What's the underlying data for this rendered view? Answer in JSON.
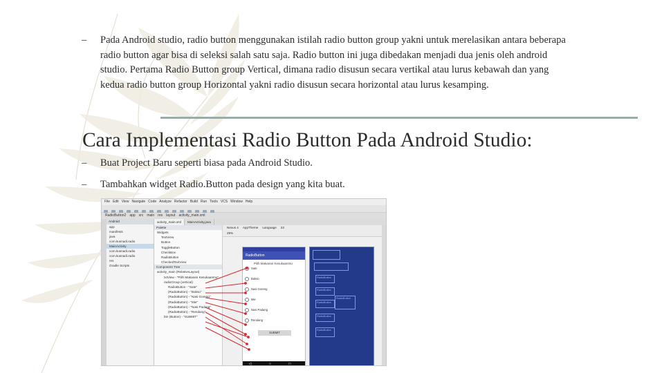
{
  "intro": {
    "dash": "–",
    "text": "Pada Android studio, radio button menggunakan istilah radio button group yakni untuk merelasikan antara beberapa radio button agar bisa di seleksi salah satu saja. Radio button ini juga dibedakan menjadi dua jenis oleh android studio. Pertama Radio Button group Vertical, dimana radio disusun secara vertikal atau lurus kebawah dan yang kedua radio button group Horizontal yakni radio disusun secara horizontal atau lurus kesamping."
  },
  "heading": "Cara Implementasi Radio Button Pada Android Studio:",
  "bullets": [
    {
      "dash": "–",
      "text": "Buat Project Baru seperti biasa pada Android Studio."
    },
    {
      "dash": "–",
      "text": "Tambahkan widget Radio.Button pada design yang kita buat."
    }
  ],
  "accent_color": "#8fb0ad",
  "screenshot": {
    "menu": [
      "File",
      "Edit",
      "View",
      "Navigate",
      "Code",
      "Analyze",
      "Refactor",
      "Build",
      "Run",
      "Tools",
      "VCS",
      "Window",
      "Help"
    ],
    "nav": [
      "RadioButton2",
      "app",
      "src",
      "main",
      "res",
      "layout",
      "activity_main.xml"
    ],
    "project_header": "Android",
    "project_items": [
      "app",
      "manifests",
      "java",
      "com.kusnadi.radio",
      "MainActivity",
      "com.kusnadi.radio",
      "com.kusnadi.radio",
      "res",
      "Gradle Scripts"
    ],
    "tabs": [
      "activity_main.xml",
      "MainActivity.java"
    ],
    "palette_header": "Palette",
    "palette_items": [
      "Widgets",
      "TextView",
      "Button",
      "ToggleButton",
      "CheckBox",
      "RadioButton",
      "CheckedTextView"
    ],
    "tree_header": "Component Tree",
    "tree_items": [
      {
        "label": "activity_main (RelativeLayout)",
        "level": 0
      },
      {
        "label": "txtView - \"Pilih Makanan Kesukaanmu\"",
        "level": 1
      },
      {
        "label": "radioGroup (vertical)",
        "level": 1
      },
      {
        "label": "RadioButton - \"Sate\"",
        "level": 2
      },
      {
        "label": "(RadioButton) - \"Bakso\"",
        "level": 2
      },
      {
        "label": "(RadioButton) - \"Nasi Goreng\"",
        "level": 2
      },
      {
        "label": "(RadioButton) - \"Mie\"",
        "level": 2
      },
      {
        "label": "(RadioButton) - \"Nasi Padang\"",
        "level": 2
      },
      {
        "label": "(RadioButton) - \"Rendang\"",
        "level": 2
      },
      {
        "label": "btn (Button) - \"SUBMIT\"",
        "level": 1
      }
    ],
    "design_toolbar": [
      "Nexus 4",
      "AppTheme",
      "Language",
      "23"
    ],
    "zoom": "29%",
    "phone": {
      "app_title": "RadioButton",
      "question": "Pilih Makanan Kesukaanmu",
      "options": [
        "Sate",
        "Bakso",
        "Nasi Goreng",
        "Mie",
        "Nasi Padang",
        "Rendang"
      ],
      "button": "SUBMIT",
      "nav_glyphs": "◁ ○ □"
    },
    "blueprint_labels": [
      "RadioButton",
      "RadioButton",
      "RadioButton",
      "RadioButton",
      "RadioButton",
      "RadioButton"
    ]
  }
}
